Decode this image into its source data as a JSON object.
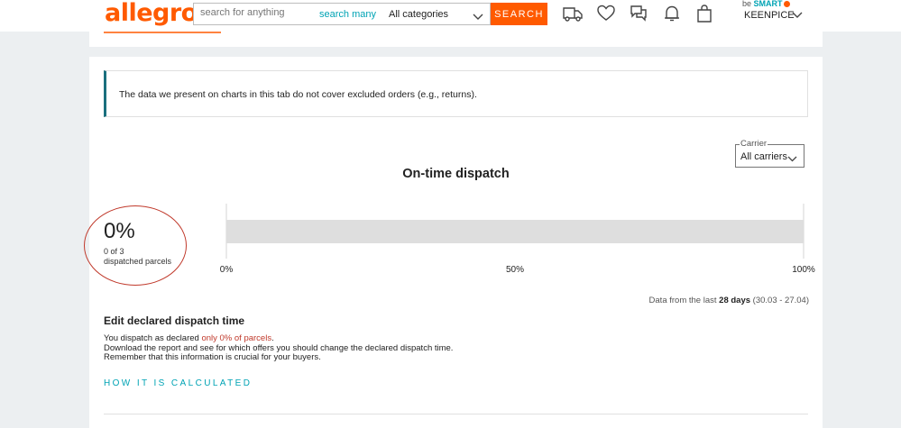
{
  "header": {
    "logo": "allegro",
    "search_placeholder": "search for anything",
    "search_many_label": "search many",
    "category_value": "All categories",
    "search_button": "SEARCH",
    "besmart_prefix": "be",
    "besmart_brand": "SMART",
    "username": "KEENPICE",
    "icons": [
      "delivery-icon",
      "heart-icon",
      "messages-icon",
      "bell-icon",
      "bag-icon"
    ],
    "accent_color": "#ff5a00",
    "link_color": "#00a3b4"
  },
  "notice": {
    "text": "The data we present on charts in this tab do not cover excluded orders (e.g., returns)."
  },
  "carrier": {
    "legend": "Carrier",
    "value": "All carriers"
  },
  "chart_title": "On-time dispatch",
  "summary": {
    "percent": "0%",
    "count": "0 of 3",
    "label": "dispatched parcels"
  },
  "chart_data": {
    "type": "bar",
    "orientation": "horizontal",
    "title": "On-time dispatch",
    "categories": [
      ""
    ],
    "values": [
      0
    ],
    "xlim": [
      0,
      100
    ],
    "x_ticks": [
      "0%",
      "50%",
      "100%"
    ],
    "track_color": "#dedede"
  },
  "data_range": {
    "prefix": "Data from the last ",
    "days": "28 days",
    "dates": " (30.03 - 27.04)"
  },
  "edit": {
    "title": "Edit declared dispatch time",
    "line1_prefix": "You dispatch as declared ",
    "line1_highlight": "only 0% of parcels",
    "line1_suffix": ".",
    "line2": "Download the report and see for which offers you should change the declared dispatch time.",
    "line3": "Remember that this information is crucial for your buyers.",
    "link": "HOW IT IS CALCULATED"
  }
}
